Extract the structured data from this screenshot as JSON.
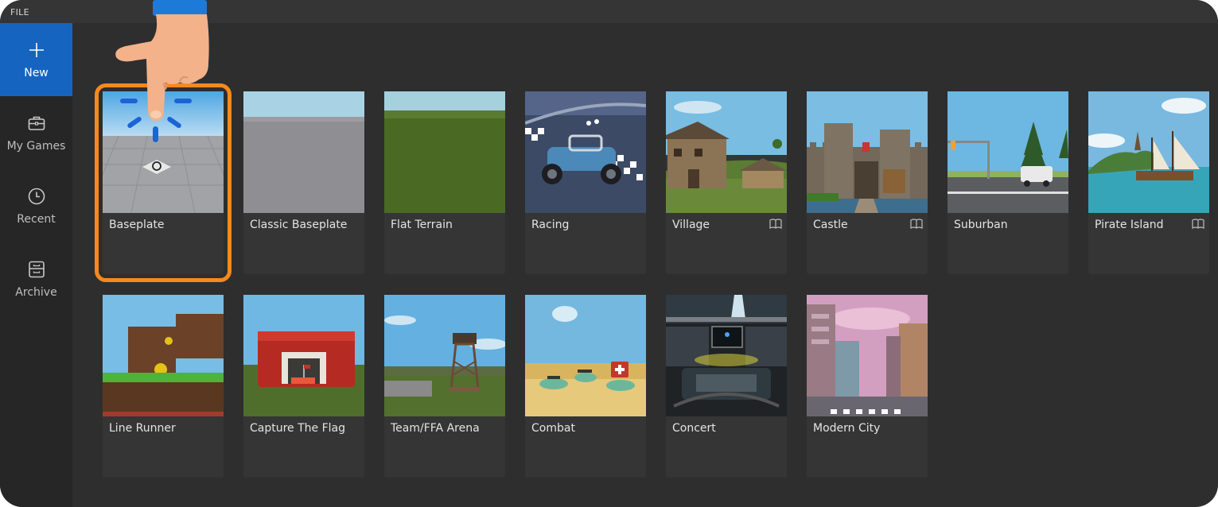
{
  "topbar": {
    "file_label": "FILE"
  },
  "sidebar": {
    "items": [
      {
        "label": "New",
        "icon": "plus-icon",
        "active": true
      },
      {
        "label": "My Games",
        "icon": "briefcase-icon"
      },
      {
        "label": "Recent",
        "icon": "clock-icon"
      },
      {
        "label": "Archive",
        "icon": "archive-icon"
      }
    ]
  },
  "templates": [
    {
      "title": "Baseplate",
      "selected": true
    },
    {
      "title": "Classic Baseplate"
    },
    {
      "title": "Flat Terrain"
    },
    {
      "title": "Racing"
    },
    {
      "title": "Village",
      "icon": "book-icon"
    },
    {
      "title": "Castle",
      "icon": "book-icon"
    },
    {
      "title": "Suburban"
    },
    {
      "title": "Pirate Island",
      "icon": "book-icon"
    },
    {
      "title": "Line Runner"
    },
    {
      "title": "Capture The Flag"
    },
    {
      "title": "Team/FFA Arena"
    },
    {
      "title": "Combat"
    },
    {
      "title": "Concert"
    },
    {
      "title": "Modern City"
    }
  ],
  "colors": {
    "accent": "#1565c0",
    "selection": "#f5891f",
    "background": "#2e2e2e"
  }
}
